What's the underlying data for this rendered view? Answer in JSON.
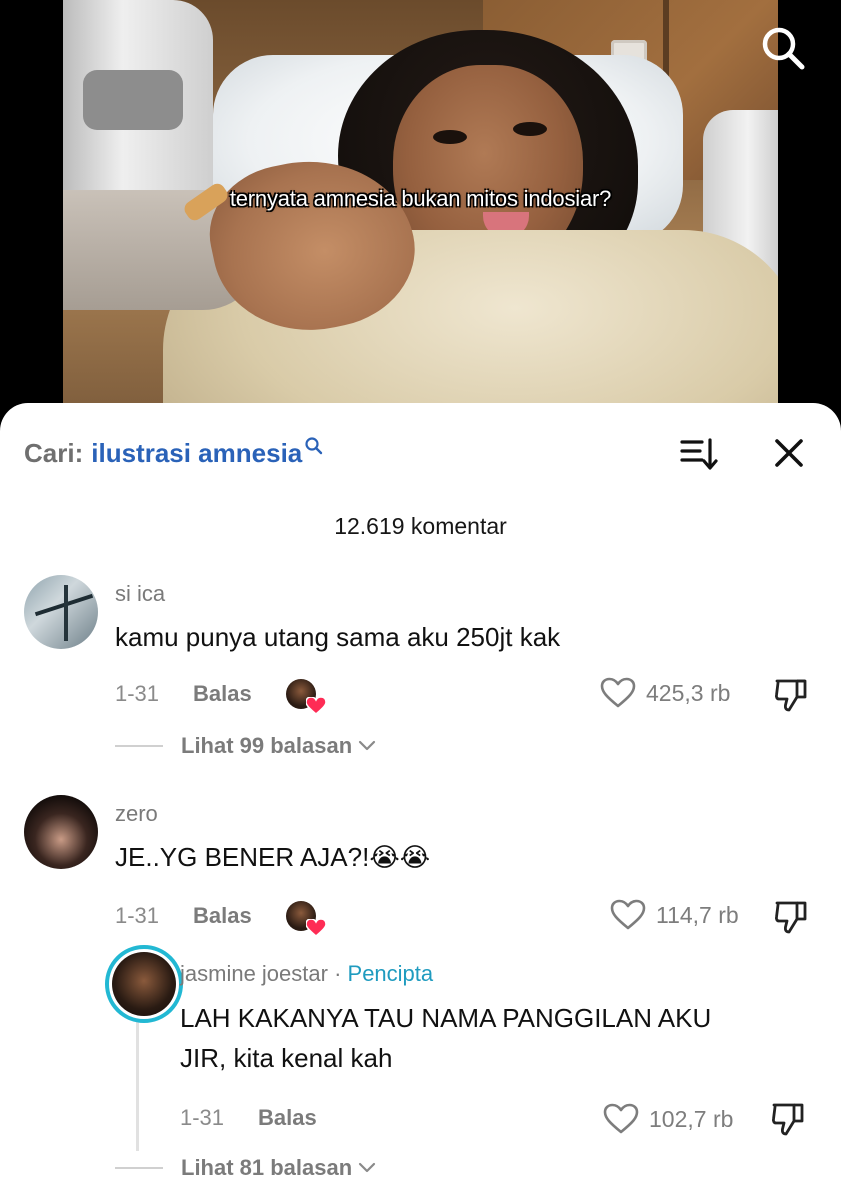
{
  "video": {
    "caption": "ternyata amnesia bukan mitos indosiar?"
  },
  "panel": {
    "search_prefix": "Cari:",
    "search_term": "ilustrasi amnesia",
    "comment_count": "12.619 komentar"
  },
  "comments": [
    {
      "username": "si ica",
      "text": "kamu punya utang sama aku 250jt kak",
      "date": "1-31",
      "reply_label": "Balas",
      "likes": "425,3 rb",
      "view_replies": "Lihat 99 balasan"
    },
    {
      "username": "zero",
      "text": "JE..YG BENER AJA?!😭😭",
      "date": "1-31",
      "reply_label": "Balas",
      "likes": "114,7 rb",
      "reply": {
        "username": "jasmine joestar",
        "separator": " · ",
        "badge": "Pencipta",
        "text_line1": "LAH KAKANYA TAU NAMA PANGGILAN AKU",
        "text_line2": "JIR, kita kenal kah",
        "date": "1-31",
        "reply_label": "Balas",
        "likes": "102,7 rb"
      },
      "view_replies": "Lihat 81 balasan"
    }
  ],
  "icons": {
    "search": "search-icon",
    "sort": "sort-icon",
    "close": "close-icon",
    "like": "heart-outline-icon",
    "dislike": "thumbs-down-icon",
    "chevron": "chevron-down-icon"
  },
  "colors": {
    "search_term": "#2a62b8",
    "creator_badge": "#1f9bbf",
    "liked_heart": "#fe2c55"
  }
}
